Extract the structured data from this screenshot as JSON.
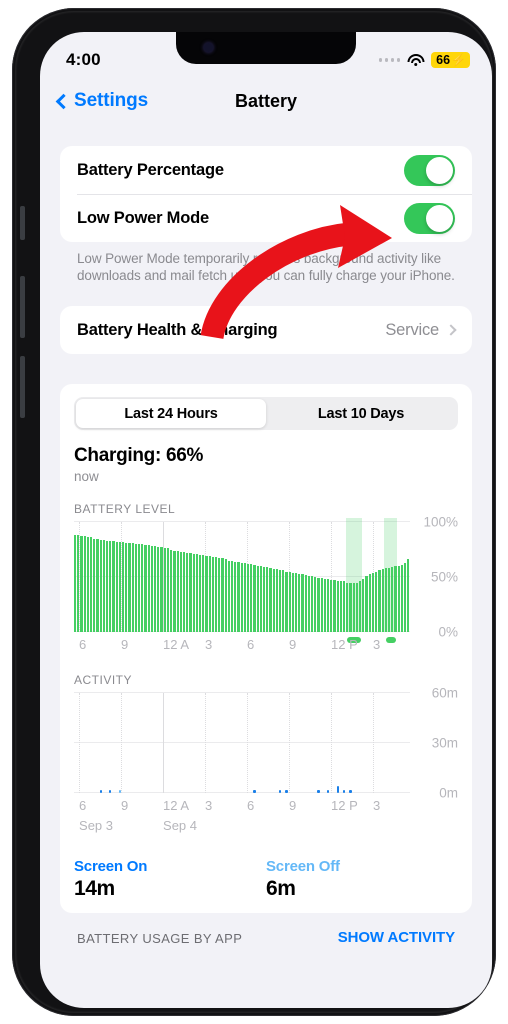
{
  "status_bar": {
    "time": "4:00",
    "signal_icon": "signal-dots-icon",
    "wifi_icon": "wifi-icon",
    "battery_percent": "66",
    "battery_bolt": "⚡",
    "battery_bg_color": "#ffd60a"
  },
  "nav": {
    "back_label": "Settings",
    "title": "Battery",
    "accent_color": "#007aff"
  },
  "settings_group": {
    "rows": [
      {
        "label": "Battery Percentage",
        "toggle": "on"
      },
      {
        "label": "Low Power Mode",
        "toggle": "on"
      }
    ],
    "footnote": "Low Power Mode temporarily reduces background activity like downloads and mail fetch until you can fully charge your iPhone."
  },
  "health_group": {
    "label": "Battery Health & Charging",
    "value": "Service",
    "chevron_icon": "chevron-right-icon"
  },
  "usage": {
    "segments": [
      {
        "label": "Last 24 Hours",
        "selected": true
      },
      {
        "label": "Last 10 Days",
        "selected": false
      }
    ],
    "charging_status": "Charging: 66%",
    "charging_time": "now",
    "battery_chart_title": "BATTERY LEVEL",
    "activity_chart_title": "ACTIVITY",
    "screen_on_label": "Screen On",
    "screen_on_value": "14m",
    "screen_off_label": "Screen Off",
    "screen_off_value": "6m"
  },
  "bottom": {
    "title": "BATTERY USAGE BY APP",
    "action": "SHOW ACTIVITY"
  },
  "annotation": {
    "type": "red-curved-arrow",
    "color": "#e8131a",
    "points_to": "Low Power Mode toggle"
  },
  "chart_data": [
    {
      "type": "bar",
      "title": "BATTERY LEVEL",
      "ylabel": "",
      "xlabel": "",
      "ylim": [
        0,
        100
      ],
      "ytick_labels": [
        "0%",
        "50%",
        "100%"
      ],
      "ytick_values": [
        0,
        50,
        100
      ],
      "xtick_labels": [
        "6",
        "9",
        "12 A",
        "3",
        "6",
        "9",
        "12 P",
        "3"
      ],
      "bar_color": "#45cf63",
      "charging_band_color": "rgba(69,207,99,0.22)",
      "grid": true,
      "values": [
        88,
        88,
        87,
        87,
        86,
        86,
        85,
        85,
        84,
        84,
        83,
        83,
        83,
        82,
        82,
        82,
        81,
        81,
        81,
        80,
        80,
        80,
        79,
        79,
        78,
        78,
        77,
        77,
        76,
        76,
        75,
        74,
        74,
        73,
        73,
        72,
        72,
        71,
        71,
        70,
        70,
        69,
        69,
        68,
        68,
        67,
        67,
        66,
        65,
        65,
        64,
        64,
        63,
        63,
        62,
        62,
        61,
        60,
        60,
        59,
        59,
        58,
        57,
        57,
        56,
        56,
        55,
        55,
        54,
        54,
        53,
        53,
        52,
        51,
        51,
        50,
        49,
        49,
        48,
        48,
        47,
        47,
        46,
        46,
        46,
        45,
        45,
        45,
        45,
        46,
        48,
        51,
        53,
        54,
        55,
        56,
        57,
        58,
        58,
        59,
        60,
        60,
        61,
        63,
        66
      ],
      "charging_bands": [
        {
          "start_index": 85,
          "end_index": 90
        },
        {
          "start_index": 97,
          "end_index": 101
        }
      ]
    },
    {
      "type": "bar",
      "title": "ACTIVITY",
      "ylabel": "",
      "xlabel": "",
      "ylim": [
        0,
        60
      ],
      "ytick_labels": [
        "0m",
        "30m",
        "60m"
      ],
      "ytick_values": [
        0,
        30,
        60
      ],
      "xtick_labels": [
        "6",
        "9",
        "12 A",
        "3",
        "6",
        "9",
        "12 P",
        "3"
      ],
      "date_labels": [
        "Sep 3",
        "Sep 4"
      ],
      "screen_on_color": "#1a7fe8",
      "screen_off_color": "#64b8f7",
      "grid": true,
      "series": [
        {
          "name": "Screen On",
          "values": [
            0,
            0,
            0,
            0,
            0,
            0,
            0,
            0,
            1,
            0,
            0,
            1,
            0,
            0,
            0,
            0,
            0,
            0,
            0,
            0,
            0,
            0,
            0,
            0,
            0,
            0,
            0,
            0,
            0,
            0,
            0,
            0,
            0,
            0,
            0,
            0,
            0,
            0,
            0,
            0,
            0,
            0,
            0,
            0,
            0,
            0,
            0,
            0,
            0,
            0,
            0,
            0,
            0,
            0,
            0,
            0,
            1,
            0,
            0,
            0,
            0,
            0,
            0,
            0,
            2,
            0,
            1,
            0,
            0,
            0,
            0,
            0,
            0,
            0,
            0,
            0,
            1,
            0,
            0,
            1,
            0,
            0,
            4,
            0,
            2,
            0,
            1,
            0,
            0,
            0,
            0,
            0,
            0,
            0,
            0,
            0,
            0,
            0,
            0,
            0,
            0,
            0,
            0,
            0,
            0
          ]
        },
        {
          "name": "Screen Off",
          "values": [
            0,
            0,
            0,
            0,
            0,
            0,
            0,
            0,
            0,
            0,
            0,
            0,
            0,
            0,
            2,
            0,
            0,
            0,
            0,
            0,
            0,
            0,
            0,
            0,
            0,
            0,
            0,
            0,
            0,
            0,
            0,
            0,
            0,
            0,
            0,
            0,
            0,
            0,
            0,
            0,
            0,
            0,
            0,
            0,
            0,
            0,
            0,
            0,
            0,
            0,
            0,
            0,
            0,
            0,
            0,
            0,
            0,
            0,
            0,
            0,
            0,
            0,
            0,
            0,
            0,
            0,
            0,
            0,
            0,
            0,
            0,
            0,
            0,
            0,
            0,
            0,
            0,
            0,
            0,
            0,
            0,
            0,
            0,
            0,
            0,
            0,
            0,
            0,
            0,
            0,
            0,
            0,
            0,
            0,
            0,
            0,
            0,
            0,
            0,
            0,
            0,
            0,
            0
          ]
        }
      ]
    }
  ]
}
